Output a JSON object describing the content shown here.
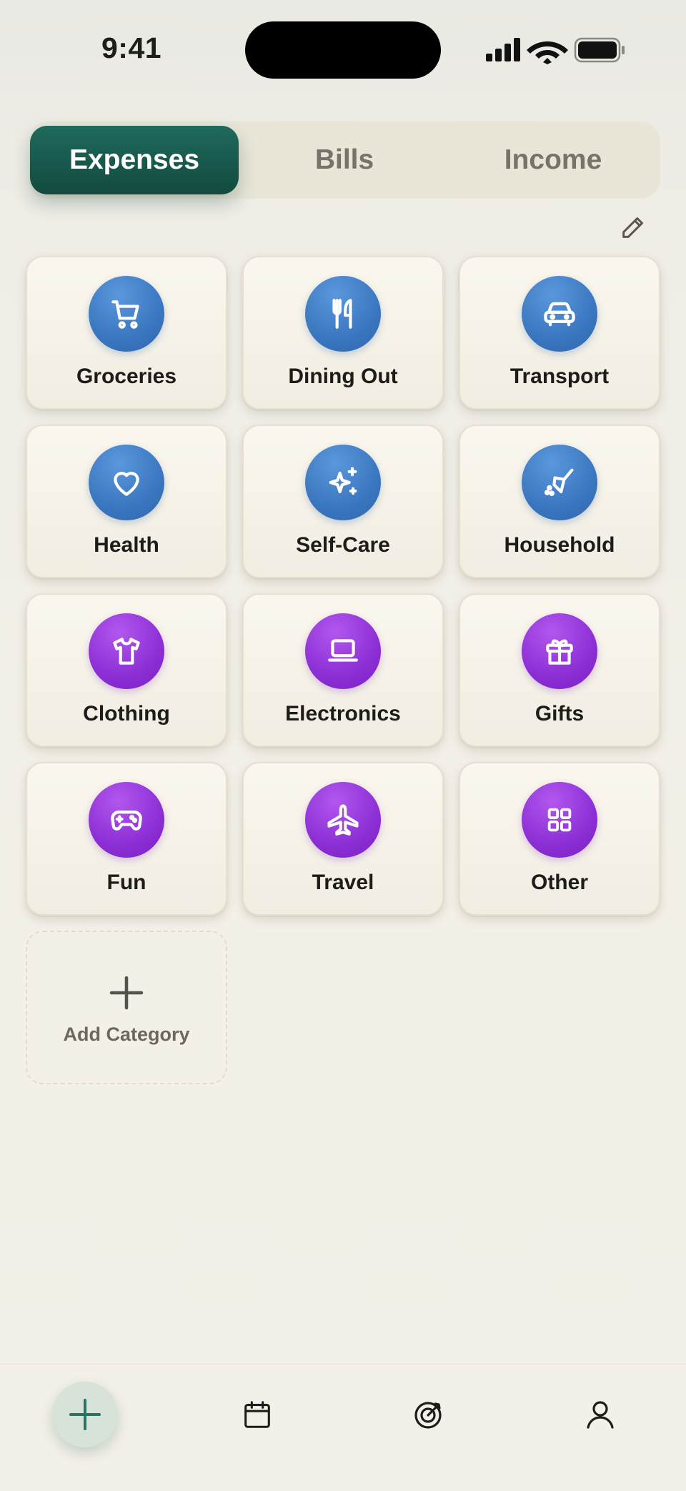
{
  "status_bar": {
    "time": "9:41",
    "icons": [
      "cellular-signal-icon",
      "wifi-icon",
      "battery-icon"
    ]
  },
  "segmented_control": {
    "tabs": [
      {
        "label": "Expenses",
        "selected": true
      },
      {
        "label": "Bills",
        "selected": false
      },
      {
        "label": "Income",
        "selected": false
      }
    ]
  },
  "edit": {
    "icon": "pencil-icon"
  },
  "categories": [
    {
      "label": "Groceries",
      "icon": "cart-icon",
      "color": "#3a77c0"
    },
    {
      "label": "Dining Out",
      "icon": "fork-knife-icon",
      "color": "#3a77c0"
    },
    {
      "label": "Transport",
      "icon": "car-icon",
      "color": "#3a77c0"
    },
    {
      "label": "Health",
      "icon": "heart-icon",
      "color": "#3a77c0"
    },
    {
      "label": "Self-Care",
      "icon": "sparkles-icon",
      "color": "#3a77c0"
    },
    {
      "label": "Household",
      "icon": "broom-icon",
      "color": "#3a77c0"
    },
    {
      "label": "Clothing",
      "icon": "shirt-icon",
      "color": "#8c2fd6"
    },
    {
      "label": "Electronics",
      "icon": "laptop-icon",
      "color": "#8c2fd6"
    },
    {
      "label": "Gifts",
      "icon": "gift-icon",
      "color": "#8c2fd6"
    },
    {
      "label": "Fun",
      "icon": "gamepad-icon",
      "color": "#8c2fd6"
    },
    {
      "label": "Travel",
      "icon": "airplane-icon",
      "color": "#8c2fd6"
    },
    {
      "label": "Other",
      "icon": "grid-icon",
      "color": "#8c2fd6"
    }
  ],
  "add_category": {
    "label": "Add Category",
    "icon": "plus-icon"
  },
  "tab_bar": {
    "items": [
      {
        "icon": "plus-icon",
        "active": true
      },
      {
        "icon": "calendar-icon"
      },
      {
        "icon": "target-icon"
      },
      {
        "icon": "person-icon"
      }
    ]
  },
  "colors": {
    "accent": "#1a5e52",
    "blue": "#3a77c0",
    "purple": "#8c2fd6",
    "background": "#f3f0e8"
  }
}
